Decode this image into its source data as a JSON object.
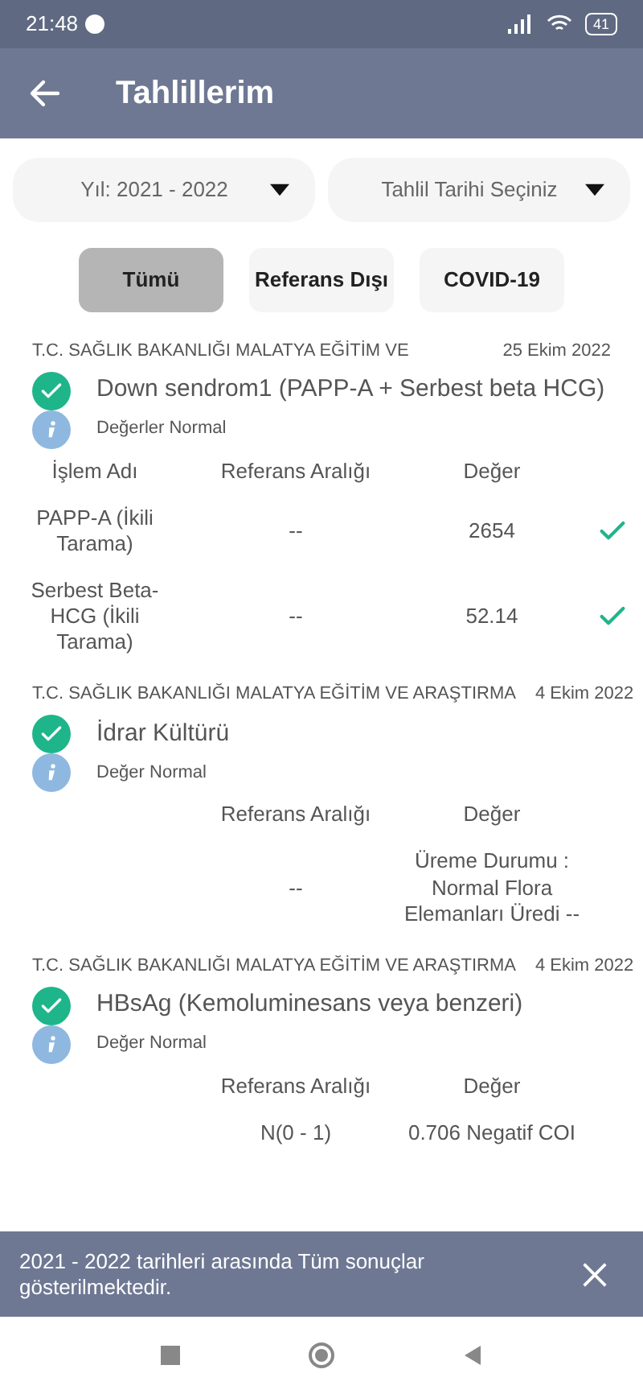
{
  "status_bar": {
    "time": "21:48",
    "battery": "41"
  },
  "app_bar": {
    "title": "Tahlillerim"
  },
  "filters": [
    {
      "value": "Yıl: 2021 - 2022"
    },
    {
      "value": "Tahlil Tarihi Seçiniz"
    }
  ],
  "tabs": [
    {
      "label": "Tümü",
      "selected": true
    },
    {
      "label": "Referans Dışı",
      "selected": false
    },
    {
      "label": "COVID-19",
      "selected": false
    }
  ],
  "results": [
    {
      "institution": "T.C. SAĞLIK BAKANLIĞI MALATYA EĞİTİM VE",
      "date": "25 Ekim 2022",
      "title": "Down sendrom1 (PAPP-A + Serbest beta HCG)",
      "status": "Değerler Normal",
      "columns": [
        "İşlem Adı",
        "Referans Aralığı",
        "Değer"
      ],
      "rows": [
        {
          "name": "PAPP-A (İkili Tarama)",
          "range": "--",
          "value": "2654",
          "checked": true
        },
        {
          "name": "Serbest Beta-HCG (İkili Tarama)",
          "range": "--",
          "value": "52.14",
          "checked": true
        }
      ]
    },
    {
      "institution": "T.C. SAĞLIK BAKANLIĞI MALATYA EĞİTİM VE ARAŞTIRMA",
      "date": "4 Ekim 2022",
      "title": "İdrar Kültürü",
      "status": "Değer Normal",
      "columns": [
        "Referans Aralığı",
        "Değer"
      ],
      "rows": [
        {
          "range": "--",
          "value": "Üreme Durumu : Normal Flora Elemanları Üredi --",
          "checked": false
        }
      ]
    },
    {
      "institution": "T.C. SAĞLIK BAKANLIĞI MALATYA EĞİTİM VE ARAŞTIRMA",
      "date": "4 Ekim 2022",
      "title": "HBsAg (Kemoluminesans veya benzeri)",
      "status": "Değer Normal",
      "columns": [
        "Referans Aralığı",
        "Değer"
      ],
      "rows": [
        {
          "range": "N(0 - 1)",
          "value": "0.706 Negatif COI",
          "checked": false
        }
      ]
    }
  ],
  "snackbar": {
    "message": "2021 - 2022 tarihleri arasında Tüm sonuçlar gösterilmektedir."
  }
}
